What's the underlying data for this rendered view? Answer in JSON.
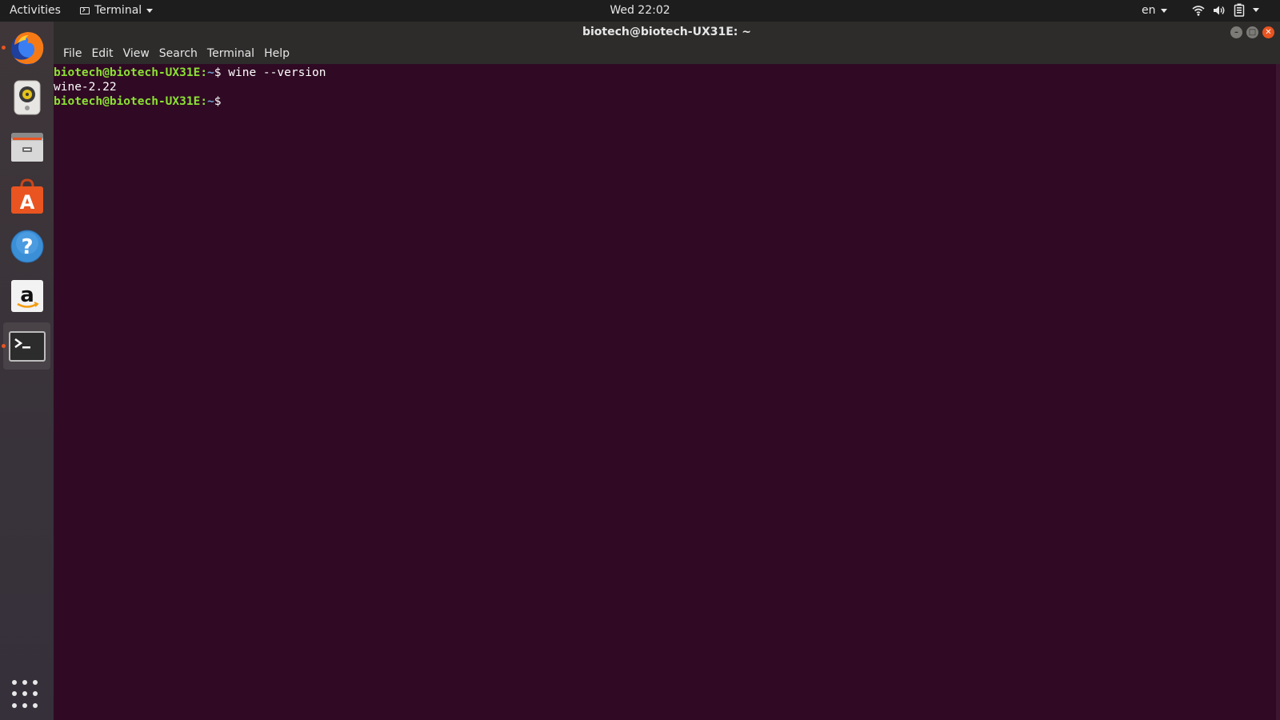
{
  "topbar": {
    "activities_label": "Activities",
    "app_menu_label": "Terminal",
    "clock": "Wed 22:02",
    "language": "en",
    "icons": [
      "terminal-icon",
      "wifi-icon",
      "volume-icon",
      "battery-icon",
      "chevron-down-icon"
    ]
  },
  "dock": {
    "items": [
      {
        "name": "firefox",
        "icon": "firefox-icon",
        "running": true
      },
      {
        "name": "rhythmbox",
        "icon": "rhythmbox-icon",
        "running": false
      },
      {
        "name": "files",
        "icon": "files-icon",
        "running": false
      },
      {
        "name": "ubuntu-software",
        "icon": "software-icon",
        "running": false
      },
      {
        "name": "help",
        "icon": "help-icon",
        "running": false
      },
      {
        "name": "amazon",
        "icon": "amazon-icon",
        "running": false
      },
      {
        "name": "terminal",
        "icon": "terminal-icon",
        "running": true,
        "active": true
      }
    ],
    "app_grid_icon": "app-grid-icon"
  },
  "window": {
    "title": "biotech@biotech-UX31E: ~",
    "menu": [
      "File",
      "Edit",
      "View",
      "Search",
      "Terminal",
      "Help"
    ],
    "lines": [
      {
        "user": "biotech@biotech-UX31E",
        "sep": ":",
        "path": "~",
        "prompt": "$ ",
        "command": "wine --version"
      },
      {
        "output": "wine-2.22"
      },
      {
        "user": "biotech@biotech-UX31E",
        "sep": ":",
        "path": "~",
        "prompt": "$ ",
        "command": ""
      }
    ]
  },
  "colors": {
    "terminal_bg": "#300a24",
    "prompt_user": "#8ae234",
    "prompt_path": "#729fcf",
    "accent": "#e95420"
  }
}
